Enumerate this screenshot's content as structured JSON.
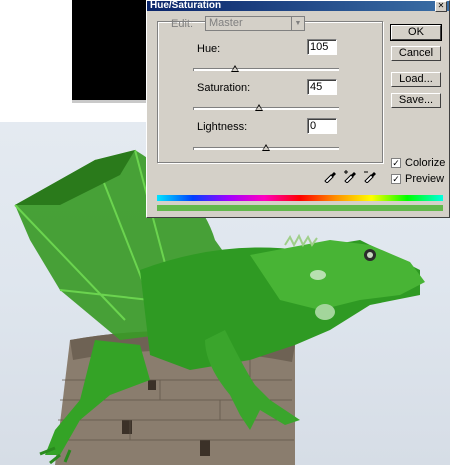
{
  "dialog": {
    "title": "Hue/Saturation",
    "edit_label": "Edit:",
    "edit_value": "Master",
    "hue_label": "Hue:",
    "hue_value": "105",
    "saturation_label": "Saturation:",
    "saturation_value": "45",
    "lightness_label": "Lightness:",
    "lightness_value": "0",
    "buttons": {
      "ok": "OK",
      "cancel": "Cancel",
      "load": "Load...",
      "save": "Save..."
    },
    "colorize_label": "Colorize",
    "preview_label": "Preview",
    "colorize_checked": true,
    "preview_checked": true,
    "slider_levels": {
      "hue": 0.29,
      "saturation": 0.45,
      "lightness": 0.5
    }
  },
  "colors": {
    "dialog_bg": "#d4d0c8",
    "titlebar": "#0a246a",
    "dragon_green": "#3fa22a",
    "colorized_bar": "#62b84c"
  }
}
